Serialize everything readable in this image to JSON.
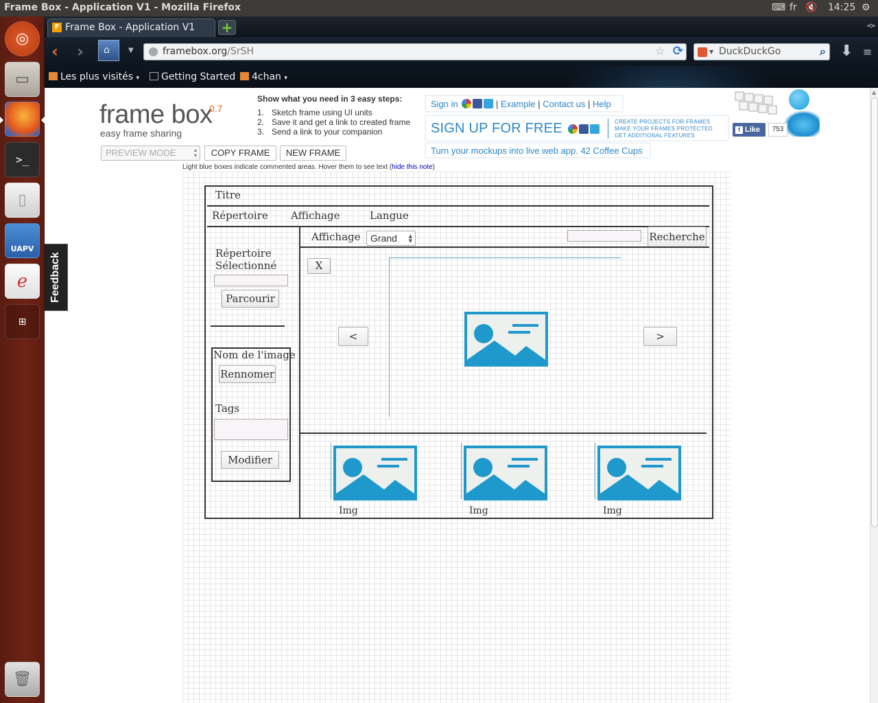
{
  "top_panel": {
    "title": "Frame Box - Application V1 - Mozilla Firefox",
    "keyboard_layout": "fr",
    "clock": "14:25"
  },
  "browser": {
    "tab_title": "Frame Box - Application V1",
    "tab_favicon_letter": "F",
    "url_host": "framebox.org",
    "url_path": "/SrSH",
    "search_engine": "DuckDuckGo",
    "bookmarks": [
      "Les plus visités",
      "Getting Started",
      "4chan"
    ]
  },
  "launcher": {
    "items": [
      "dash-home",
      "file-manager",
      "firefox",
      "terminal",
      "text-editor",
      "uapv",
      "pdf-viewer",
      "workspace-switcher",
      "trash"
    ],
    "uapv_label": "UAPV"
  },
  "header": {
    "logo": "frame box",
    "version": "0.7",
    "tagline": "easy frame sharing",
    "mode_select": "PREVIEW MODE",
    "copy_frame": "COPY FRAME",
    "new_frame": "NEW FRAME"
  },
  "steps": {
    "heading": "Show what you need in 3 easy steps:",
    "items": [
      {
        "num": "1.",
        "text": "Sketch frame using UI units"
      },
      {
        "num": "2.",
        "text": "Save it and get a link to created frame"
      },
      {
        "num": "3.",
        "text": "Send a link to your companion"
      }
    ]
  },
  "promo": {
    "sign_in": "Sign in",
    "sep": "|",
    "example": "Example",
    "contact": "Contact us",
    "help": "Help",
    "signup": "SIGN UP FOR FREE",
    "feature1": "CREATE PROJECTS FOR FRAMES",
    "feature2": "MAKE YOUR FRAMES PROTECTED",
    "feature3": "GET ADDITIONAL FEATURES",
    "coffee": "Turn your mockups into live web app. 42 Coffee Cups",
    "fb_like": "Like",
    "fb_count": "753"
  },
  "note": {
    "text": "Light blue boxes indicate commented areas. Hover them to see text (",
    "link": "hide this note",
    "close": ")"
  },
  "feedback": "Feedback",
  "mockup": {
    "title": "Titre",
    "menus": [
      "Répertoire",
      "Affichage",
      "Langue"
    ],
    "view_label": "Affichage",
    "view_value": "Grand",
    "search_button": "Recherche",
    "dir_label_1": "Répertoire",
    "dir_label_2": "Sélectionné",
    "browse_button": "Parcourir",
    "image_name_label": "Nom de l'image",
    "rename_button": "Rennomer",
    "tags_label": "Tags",
    "modify_button": "Modifier",
    "close_button": "X",
    "prev_button": "<",
    "next_button": ">",
    "thumb_labels": [
      "Img",
      "Img",
      "Img"
    ]
  }
}
